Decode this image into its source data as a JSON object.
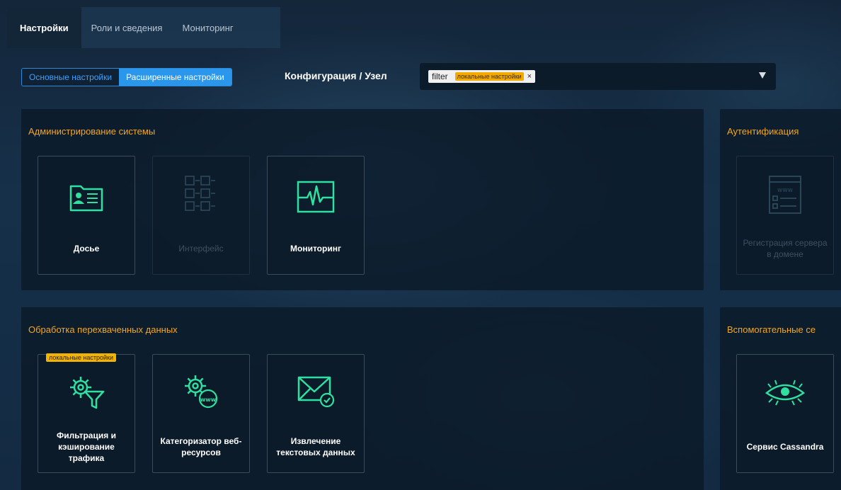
{
  "tabs": [
    {
      "label": "Настройки",
      "active": true
    },
    {
      "label": "Роли и сведения",
      "active": false
    },
    {
      "label": "Мониторинг",
      "active": false
    }
  ],
  "toolbar": {
    "basic_label": "Основные настройки",
    "advanced_label": "Расширенные настройки",
    "breadcrumb": "Конфигурация / Узел"
  },
  "filter": {
    "chip_text": "filter",
    "chip_tag": "локальные настройки",
    "chip_close": "×"
  },
  "panels": {
    "admin": {
      "title": "Администрирование системы",
      "tiles": [
        {
          "label": "Досье",
          "icon": "dossier-card-icon",
          "enabled": true
        },
        {
          "label": "Интерфейс",
          "icon": "interface-grid-icon",
          "enabled": false
        },
        {
          "label": "Мониторинг",
          "icon": "heartbeat-monitor-icon",
          "enabled": true
        }
      ]
    },
    "auth": {
      "title": "Аутентификация",
      "tiles": [
        {
          "label": "Регистрация сервера в домене",
          "icon": "www-browser-icon",
          "enabled": false
        }
      ]
    },
    "processing": {
      "title": "Обработка перехваченных данных",
      "tiles": [
        {
          "label": "Фильтрация и кэширование трафика",
          "icon": "gear-filter-icon",
          "enabled": true,
          "badge": "локальные настройки"
        },
        {
          "label": "Категоризатор веб-ресурсов",
          "icon": "gear-www-icon",
          "enabled": true
        },
        {
          "label": "Извлечение текстовых данных",
          "icon": "envelope-check-icon",
          "enabled": true
        }
      ]
    },
    "aux": {
      "title": "Вспомогательные се",
      "tiles": [
        {
          "label": "Сервис Cassandra",
          "icon": "cassandra-eye-icon",
          "enabled": true
        }
      ]
    }
  },
  "colors": {
    "accent": "#2a96ec",
    "section_title": "#f5a623",
    "icon_green": "#2fe0a0",
    "badge": "#f2b400"
  }
}
